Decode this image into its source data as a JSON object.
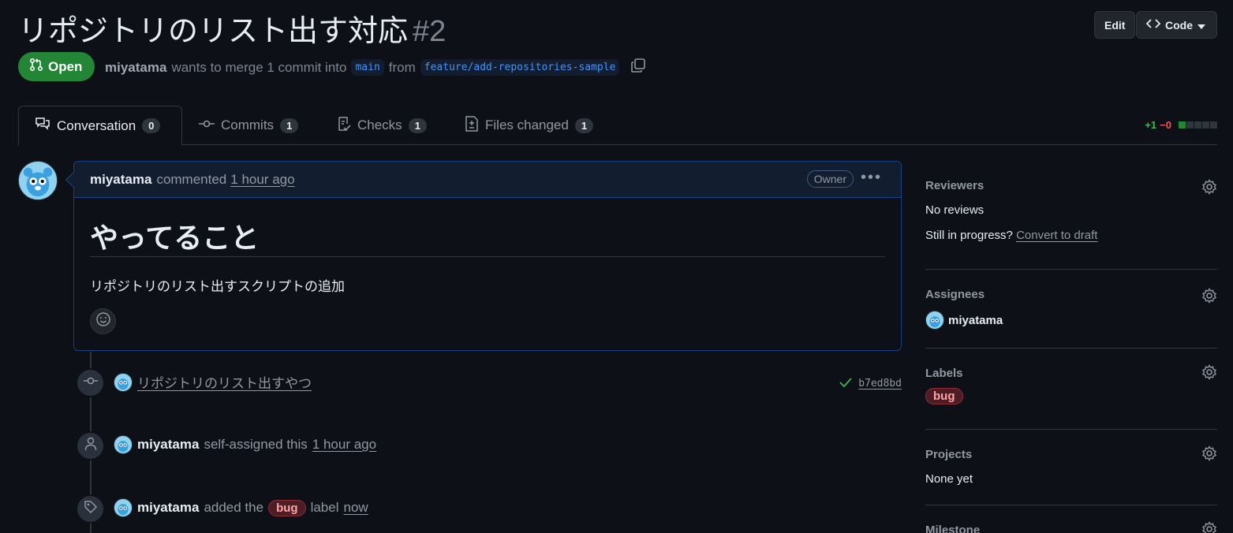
{
  "pr": {
    "title": "リポジトリのリスト出す対応",
    "number": "#2",
    "state": "Open",
    "author": "miyatama",
    "merge_text": "wants to merge 1 commit into",
    "base_branch": "main",
    "from_text": "from",
    "head_branch": "feature/add-repositories-sample"
  },
  "header_buttons": {
    "edit": "Edit",
    "code": "Code"
  },
  "tabs": [
    {
      "label": "Conversation",
      "count": "0"
    },
    {
      "label": "Commits",
      "count": "1"
    },
    {
      "label": "Checks",
      "count": "1"
    },
    {
      "label": "Files changed",
      "count": "1"
    }
  ],
  "diffstat": {
    "additions": "+1",
    "deletions": "−0"
  },
  "comment": {
    "author": "miyatama",
    "action": "commented",
    "time": "1 hour ago",
    "badge": "Owner",
    "heading": "やってること",
    "body": "リポジトリのリスト出すスクリプトの追加"
  },
  "timeline": {
    "commit_message": "リポジトリのリスト出すやつ",
    "commit_sha": "b7ed8bd",
    "assign_user": "miyatama",
    "assign_text": "self-assigned this",
    "assign_time": "1 hour ago",
    "label_user": "miyatama",
    "label_text_1": "added the",
    "label_name": "bug",
    "label_text_2": "label",
    "label_time": "now"
  },
  "sidebar": {
    "reviewers_title": "Reviewers",
    "reviewers_value": "No reviews",
    "progress_text": "Still in progress?",
    "convert_link": "Convert to draft",
    "assignees_title": "Assignees",
    "assignee": "miyatama",
    "labels_title": "Labels",
    "label": "bug",
    "projects_title": "Projects",
    "projects_value": "None yet",
    "milestone_title": "Milestone"
  },
  "colors": {
    "open_green": "#238636",
    "link_blue": "#4493f8",
    "label_red": "#ffa4a9"
  }
}
